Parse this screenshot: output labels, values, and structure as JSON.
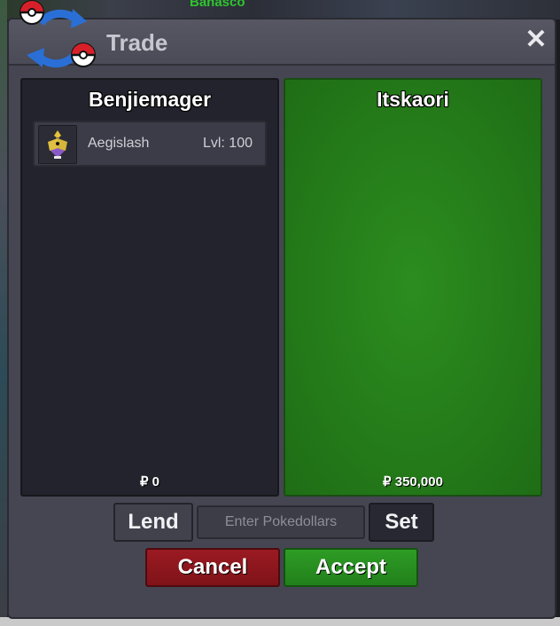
{
  "background": {
    "name_text": "Banasco"
  },
  "window": {
    "title": "Trade",
    "close_label": "✕",
    "logo_icon": "trade-swap-pokeball-icon"
  },
  "left_panel": {
    "player_name": "Benjiemager",
    "items": [
      {
        "icon": "aegislash-icon",
        "name": "Aegislash",
        "level": "Lvl: 100"
      }
    ],
    "money": "₽ 0"
  },
  "right_panel": {
    "player_name": "Itskaori",
    "items": [],
    "money": "₽ 350,000",
    "accent_color": "#2a8a1e"
  },
  "controls": {
    "lend_label": "Lend",
    "money_placeholder": "Enter Pokedollars",
    "set_label": "Set",
    "cancel_label": "Cancel",
    "accept_label": "Accept"
  },
  "colors": {
    "cancel": "#8c161d",
    "accept": "#27901f",
    "window": "#454652"
  }
}
